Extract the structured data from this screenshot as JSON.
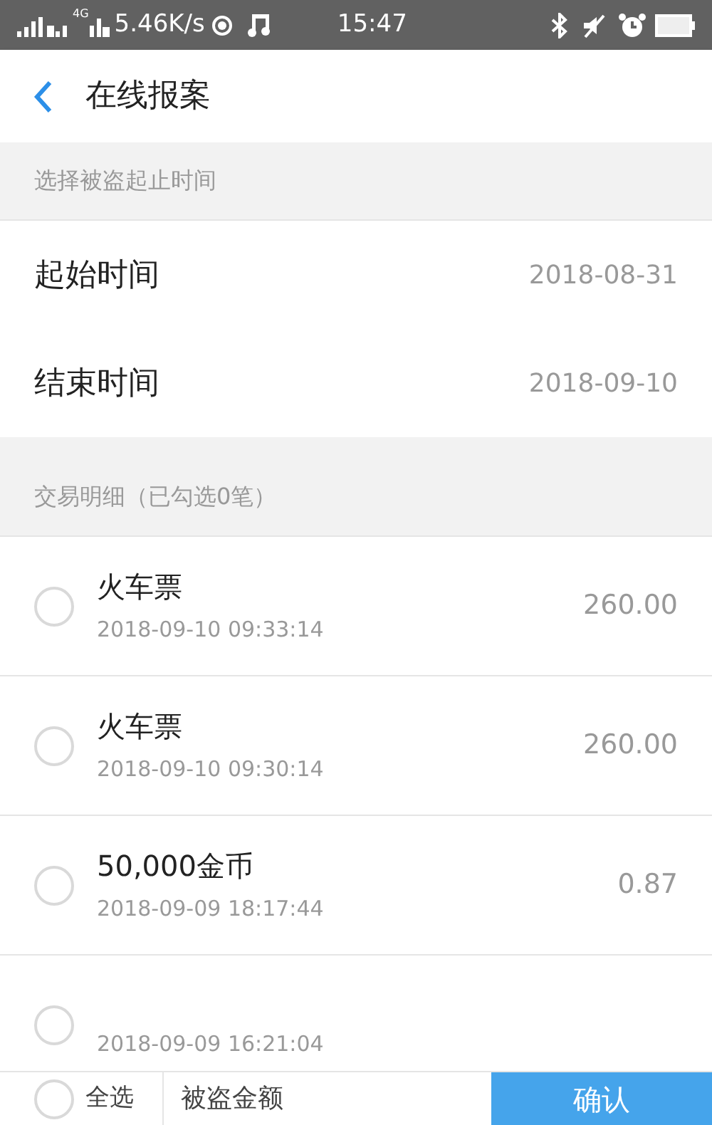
{
  "status_bar": {
    "network": "4G",
    "speed": "5.46K/s",
    "time": "15:47"
  },
  "header": {
    "title": "在线报案"
  },
  "period": {
    "section_title": "选择被盗起止时间",
    "rows": [
      {
        "label": "起始时间",
        "value": "2018-08-31"
      },
      {
        "label": "结束时间",
        "value": "2018-09-10"
      }
    ]
  },
  "transactions": {
    "section_title": "交易明细（已勾选0笔）",
    "items": [
      {
        "title": "火车票",
        "time": "2018-09-10 09:33:14",
        "amount": "260.00",
        "checked": false
      },
      {
        "title": "火车票",
        "time": "2018-09-10 09:30:14",
        "amount": "260.00",
        "checked": false
      },
      {
        "title": "50,000金币",
        "time": "2018-09-09 18:17:44",
        "amount": "0.87",
        "checked": false
      },
      {
        "time": "2018-09-09 16:21:04",
        "checked": false
      }
    ]
  },
  "footer": {
    "select_all": {
      "label": "全选",
      "checked": false
    },
    "amount_label": "被盗金额",
    "confirm": "确认"
  }
}
